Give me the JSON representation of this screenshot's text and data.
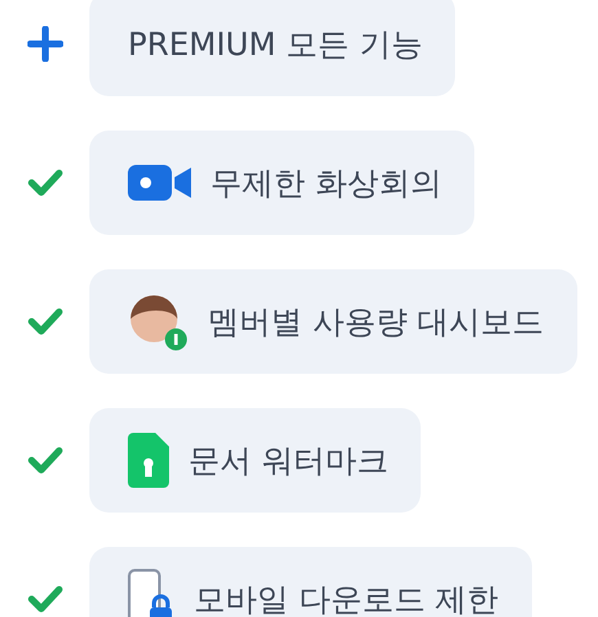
{
  "features": [
    {
      "kind": "plan",
      "label": "PREMIUM 모든 기능"
    },
    {
      "kind": "video",
      "label": "무제한 화상회의"
    },
    {
      "kind": "member",
      "label": "멤버별 사용량 대시보드"
    },
    {
      "kind": "document",
      "label": "문서 워터마크"
    },
    {
      "kind": "mobile",
      "label": "모바일 다운로드 제한"
    }
  ]
}
